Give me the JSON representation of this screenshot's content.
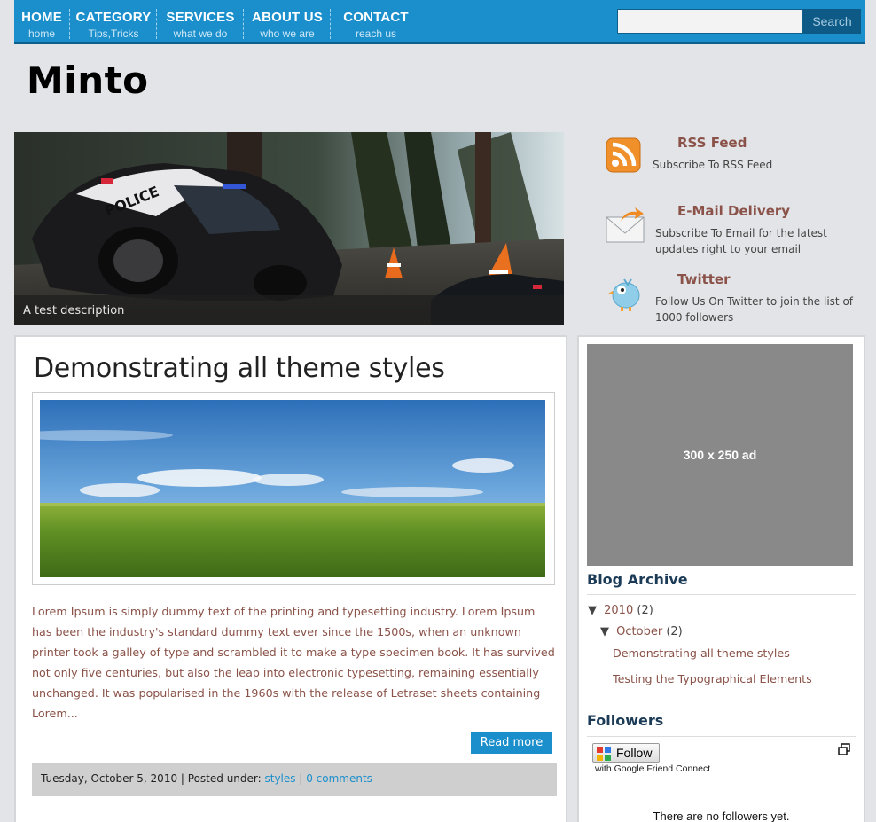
{
  "nav": {
    "items": [
      {
        "title": "HOME",
        "sub": "home"
      },
      {
        "title": "CATEGORY",
        "sub": "Tips,Tricks"
      },
      {
        "title": "SERVICES",
        "sub": "what we do"
      },
      {
        "title": "ABOUT US",
        "sub": "who we are"
      },
      {
        "title": "CONTACT",
        "sub": "reach us"
      }
    ],
    "search_placeholder": "",
    "search_label": "Search"
  },
  "site": {
    "title": "Minto"
  },
  "slider": {
    "caption": "A test description",
    "badge_text": "POLICE"
  },
  "subscribe": [
    {
      "icon": "rss-icon",
      "title": "RSS Feed",
      "desc": "Subscribe To RSS Feed"
    },
    {
      "icon": "email-icon",
      "title": "E-Mail Delivery",
      "desc": "Subscribe To Email for the latest updates right to your email"
    },
    {
      "icon": "twitter-bird-icon",
      "title": "Twitter",
      "desc": "Follow Us On Twitter to join the list of 1000 followers"
    }
  ],
  "post": {
    "title": "Demonstrating all theme styles",
    "excerpt": "Lorem Ipsum is simply dummy text of the printing and typesetting industry. Lorem Ipsum has been the industry's standard dummy text ever since the 1500s, when an unknown printer took a galley of type and scrambled it to make a type specimen book. It has survived not only five centuries, but also the leap into electronic typesetting, remaining essentially unchanged. It was popularised in the 1960s with the release of Letraset sheets containing Lorem...",
    "read_more": "Read more",
    "date": "Tuesday, October 5, 2010",
    "sep1": " | Posted under: ",
    "category": "styles",
    "sep2": " | ",
    "comments": "0 comments"
  },
  "sidebar": {
    "ad_text": "300 x 250 ad",
    "archive_title": "Blog Archive",
    "archive": {
      "year": "2010",
      "year_count": "(2)",
      "month": "October",
      "month_count": "(2)",
      "posts": [
        "Demonstrating all theme styles",
        "Testing the Typographical Elements"
      ]
    },
    "followers_title": "Followers",
    "follow_label": "Follow",
    "gfc_text": "with Google Friend Connect",
    "no_followers": "There are no followers yet."
  },
  "colors": {
    "nav": "#1a8fcc",
    "nav_border": "#0d5f8c",
    "accent_text": "#8a5248",
    "widget_title": "#1c3b57"
  }
}
